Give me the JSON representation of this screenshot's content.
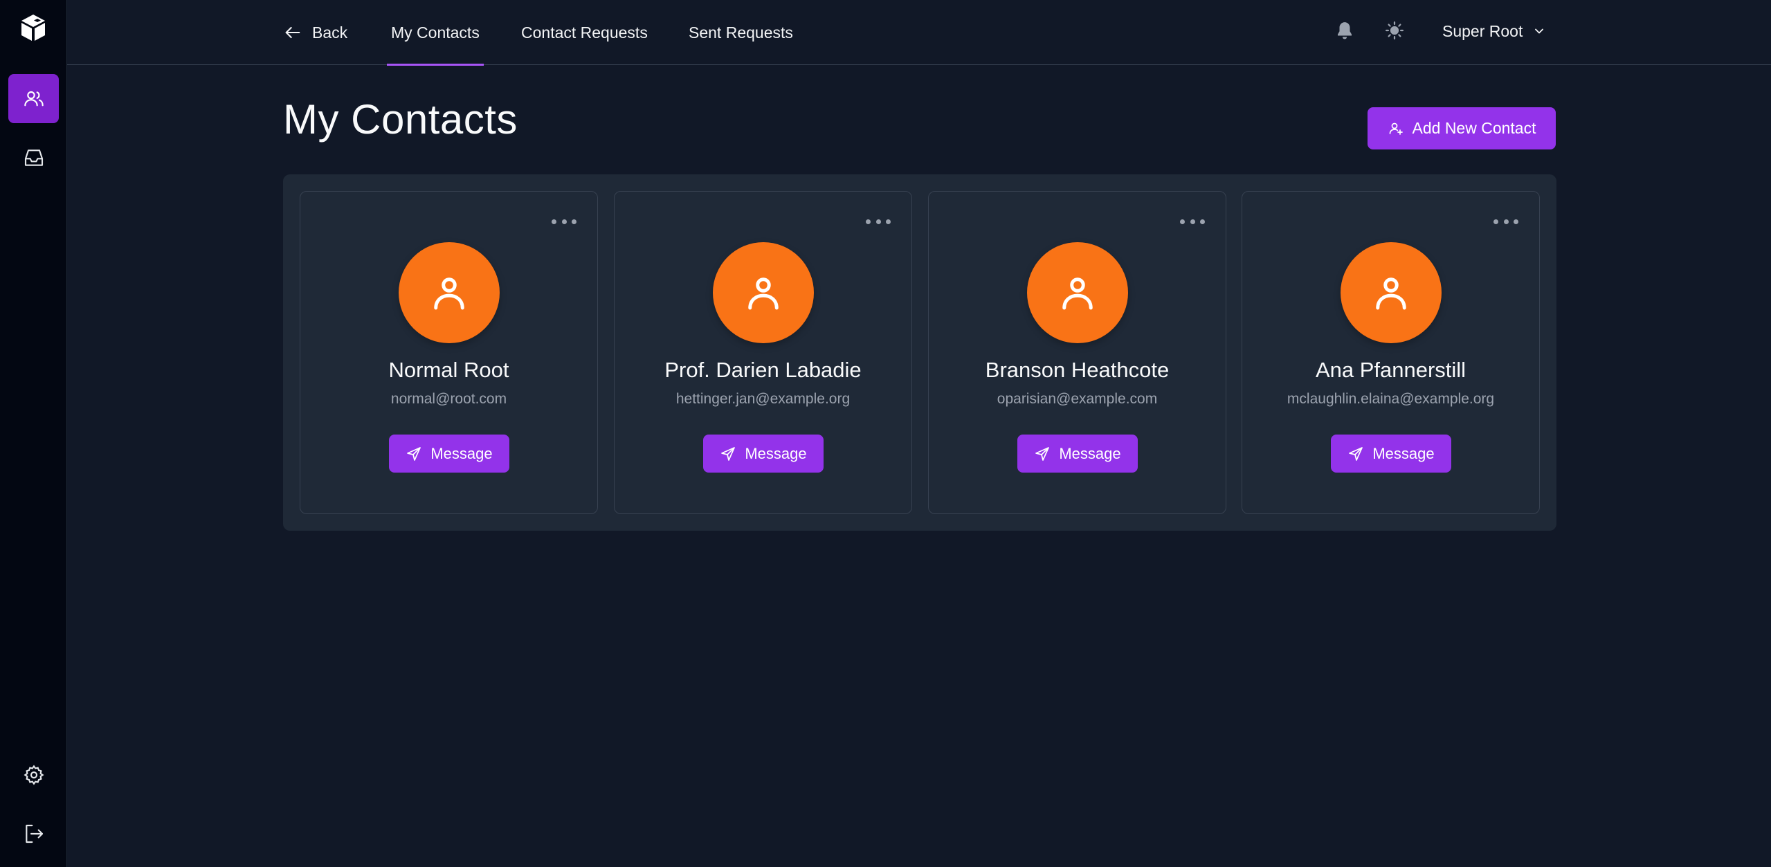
{
  "nav": {
    "back_label": "Back",
    "tabs": [
      {
        "label": "My Contacts",
        "active": true
      },
      {
        "label": "Contact Requests",
        "active": false
      },
      {
        "label": "Sent Requests",
        "active": false
      }
    ],
    "user_name": "Super Root"
  },
  "sidebar": {
    "items": [
      {
        "icon": "users-icon",
        "active": true
      },
      {
        "icon": "inbox-icon",
        "active": false
      }
    ],
    "bottom": [
      {
        "icon": "gear-icon"
      },
      {
        "icon": "logout-icon"
      }
    ]
  },
  "page": {
    "title": "My Contacts",
    "add_button_label": "Add New Contact"
  },
  "contacts": [
    {
      "name": "Normal Root",
      "email": "normal@root.com",
      "action": "Message"
    },
    {
      "name": "Prof. Darien Labadie",
      "email": "hettinger.jan@example.org",
      "action": "Message"
    },
    {
      "name": "Branson Heathcote",
      "email": "oparisian@example.com",
      "action": "Message"
    },
    {
      "name": "Ana Pfannerstill",
      "email": "mclaughlin.elaina@example.org",
      "action": "Message"
    }
  ],
  "colors": {
    "accent": "#9333ea",
    "avatar": "#f97316",
    "background": "#111827",
    "panel": "#1f2937",
    "sidebar": "#030712"
  }
}
